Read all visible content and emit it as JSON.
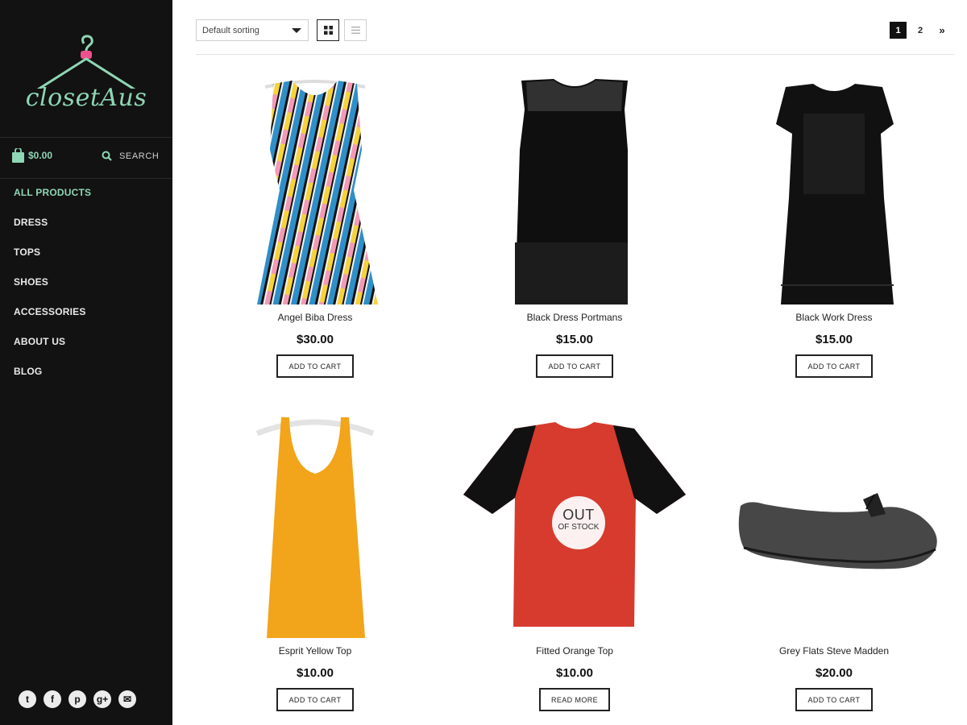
{
  "brand": {
    "name": "closetAus",
    "accent": "#8fd6b4"
  },
  "sidebar": {
    "cart_total": "$0.00",
    "search_label": "SEARCH",
    "nav": [
      {
        "label": "ALL PRODUCTS",
        "active": true
      },
      {
        "label": "DRESS"
      },
      {
        "label": "TOPS"
      },
      {
        "label": "SHOES"
      },
      {
        "label": "ACCESSORIES"
      },
      {
        "label": "ABOUT US"
      },
      {
        "label": "BLOG"
      }
    ],
    "social": [
      {
        "icon": "twitter-icon",
        "glyph": "t"
      },
      {
        "icon": "facebook-icon",
        "glyph": "f"
      },
      {
        "icon": "pinterest-icon",
        "glyph": "p"
      },
      {
        "icon": "google-plus-icon",
        "glyph": "g+"
      },
      {
        "icon": "email-icon",
        "glyph": "✉"
      }
    ]
  },
  "toolbar": {
    "sort_selected": "Default sorting",
    "pagination": {
      "pages": [
        "1",
        "2"
      ],
      "current": "1",
      "next": "»"
    }
  },
  "products": [
    {
      "title": "Angel Biba Dress",
      "price": "$30.00",
      "button": "ADD TO CART"
    },
    {
      "title": "Black Dress Portmans",
      "price": "$15.00",
      "button": "ADD TO CART"
    },
    {
      "title": "Black Work Dress",
      "price": "$15.00",
      "button": "ADD TO CART"
    },
    {
      "title": "Esprit Yellow Top",
      "price": "$10.00",
      "button": "ADD TO CART"
    },
    {
      "title": "Fitted Orange Top",
      "price": "$10.00",
      "button": "READ MORE",
      "badge": {
        "line1": "OUT",
        "line2": "OF STOCK"
      }
    },
    {
      "title": "Grey Flats Steve Madden",
      "price": "$20.00",
      "button": "ADD TO CART"
    }
  ]
}
